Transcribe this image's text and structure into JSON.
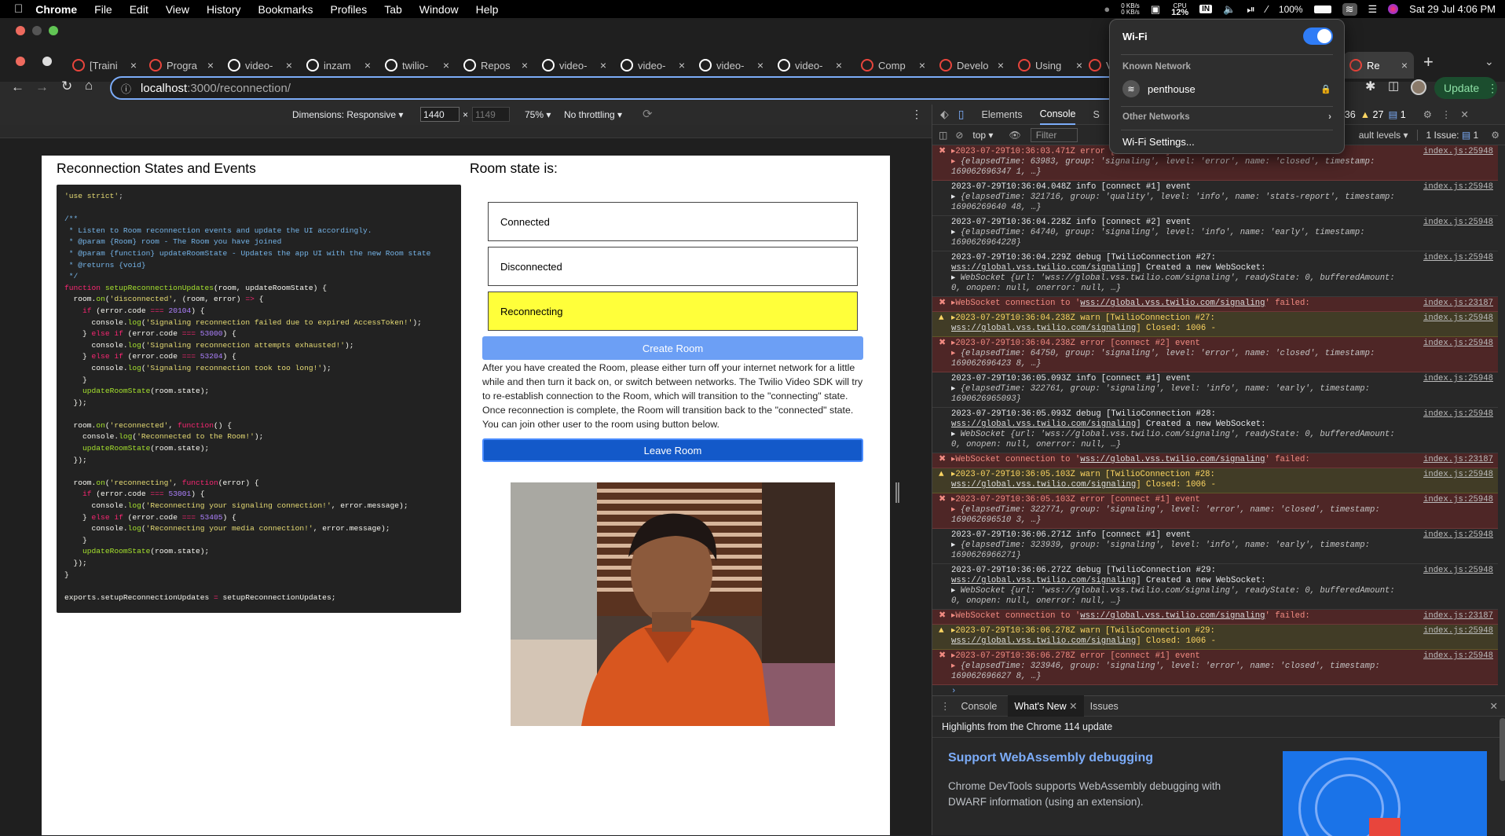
{
  "menubar": {
    "app": "Chrome",
    "items": [
      "File",
      "Edit",
      "View",
      "History",
      "Bookmarks",
      "Profiles",
      "Tab",
      "Window",
      "Help"
    ],
    "net_up": "0 KB/s",
    "net_down": "0 KB/s",
    "cpu_label": "CPU",
    "cpu": "12%",
    "input_source": "IN",
    "battery": "100%",
    "clock": "Sat 29 Jul  4:06 PM"
  },
  "tabs": [
    {
      "label": "[Traini",
      "color": "#e8453c"
    },
    {
      "label": "Progra",
      "color": "#e8453c"
    },
    {
      "label": "video-",
      "color": "#ffffff"
    },
    {
      "label": "inzam",
      "color": "#ffffff"
    },
    {
      "label": "twilio-",
      "color": "#ffffff"
    },
    {
      "label": "Repos",
      "color": "#ffffff"
    },
    {
      "label": "video-",
      "color": "#ffffff"
    },
    {
      "label": "video-",
      "color": "#ffffff"
    },
    {
      "label": "video-",
      "color": "#ffffff"
    },
    {
      "label": "video-",
      "color": "#ffffff"
    },
    {
      "label": "Comp",
      "color": "#e8453c"
    },
    {
      "label": "Develo",
      "color": "#e8453c"
    },
    {
      "label": "Using",
      "color": "#e8453c"
    },
    {
      "label": "Vi",
      "color": "#e8453c"
    },
    {
      "label": "Re",
      "color": "#e8453c"
    }
  ],
  "address": {
    "host": "localhost",
    "path": ":3000/reconnection/"
  },
  "update_label": "Update",
  "devbar": {
    "dimensions": "Dimensions: Responsive",
    "width": "1440",
    "height": "1149",
    "zoom": "75%",
    "throttle": "No throttling"
  },
  "page": {
    "left_title": "Reconnection States and Events",
    "right_title": "Room state is:",
    "states": [
      "Connected",
      "Disconnected",
      "Reconnecting"
    ],
    "active_state_color": "#ffff3a",
    "create_button": "Create Room",
    "leave_button": "Leave Room",
    "paragraph": "After you have created the Room, please either turn off your internet network for a little while and then turn it back on, or switch between networks. The Twilio Video SDK will try to re-establish connection to the Room, which will transition to the \"connecting\" state. Once reconnection is complete, the Room will transition back to the \"connected\" state. You can join other user to the room using button below."
  },
  "devtools": {
    "tabs": [
      "Elements",
      "Console",
      "S"
    ],
    "active_tab": "Console",
    "errors": "36",
    "warnings": "27",
    "info": "1",
    "context": "top",
    "filter_placeholder": "Filter",
    "levels": "ault levels",
    "issues": "1 Issue:",
    "issues_count": "1",
    "drawer_tabs": [
      "Console",
      "What's New",
      "Issues"
    ],
    "drawer_active": "What's New",
    "whatsnew_highlight": "Highlights from the Chrome 114 update",
    "whatsnew_title": "Support WebAssembly debugging",
    "whatsnew_body": "Chrome DevTools supports WebAssembly debugging with DWARF information (using an extension)."
  },
  "wifi": {
    "title": "Wi-Fi",
    "known_header": "Known Network",
    "network": "penthouse",
    "other_header": "Other Networks",
    "settings": "Wi-Fi Settings..."
  }
}
